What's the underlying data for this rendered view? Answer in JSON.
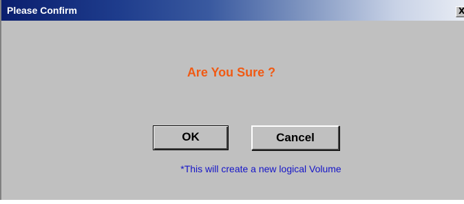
{
  "window": {
    "title": "Please Confirm",
    "close_glyph": "X",
    "close_icon": "close-icon"
  },
  "dialog": {
    "question": "Are You Sure ?",
    "ok_label": "OK",
    "cancel_label": "Cancel",
    "note": "*This will create a new logical Volume"
  },
  "colors": {
    "question": "#f05a14",
    "note": "#1414c8",
    "background": "#c0c0c0",
    "titlebar_start": "#0a1e6e"
  }
}
